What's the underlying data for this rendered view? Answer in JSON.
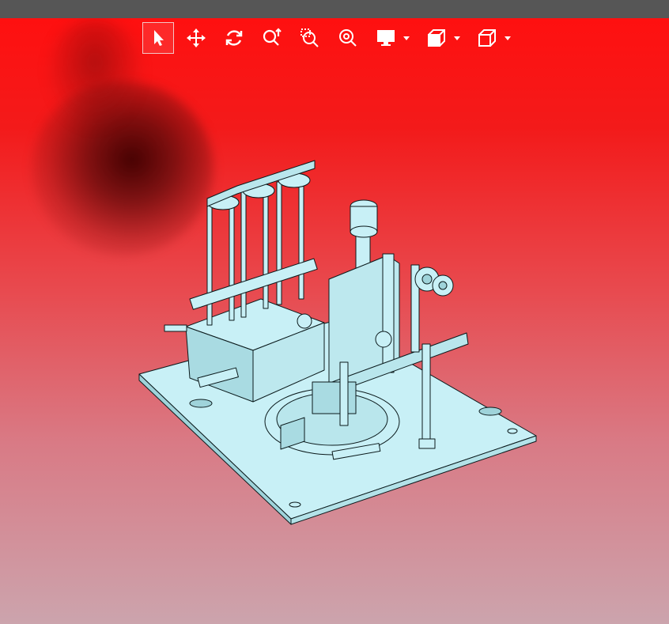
{
  "toolbar": {
    "tools": [
      {
        "name": "select",
        "icon": "cursor-arrow-icon",
        "active": true
      },
      {
        "name": "pan",
        "icon": "move-arrows-icon"
      },
      {
        "name": "rotate",
        "icon": "rotate-icon"
      },
      {
        "name": "zoom",
        "icon": "zoom-updown-icon"
      },
      {
        "name": "zoom-window",
        "icon": "zoom-window-icon"
      },
      {
        "name": "zoom-fit",
        "icon": "zoom-fit-icon"
      },
      {
        "name": "display-mode",
        "icon": "monitor-icon",
        "dropdown": true
      },
      {
        "name": "section",
        "icon": "section-cube-icon",
        "dropdown": true
      },
      {
        "name": "view-orientation",
        "icon": "cube-icon",
        "dropdown": true
      }
    ]
  },
  "colors": {
    "topbar": "#565656",
    "background_top": "#ff1010",
    "background_bottom": "#cca4ad",
    "model_fill": "#c8f0f6",
    "model_edge": "#0b1a1c",
    "toolbar_icon": "#ffffff"
  }
}
